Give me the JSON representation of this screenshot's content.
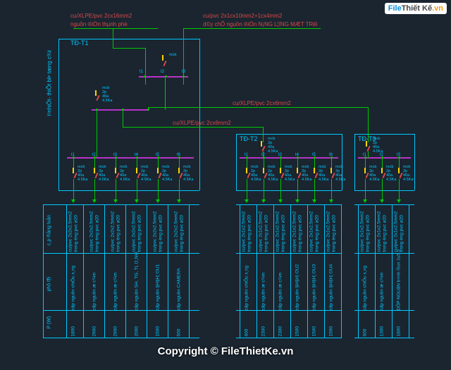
{
  "logo": {
    "text1": "File",
    "text2": "Thiết Kế",
    "text3": ".vn"
  },
  "cables": {
    "c1": "cu/XLPE/pvc 2cx16mm2",
    "c2": "nguồn ®iÖn thµnh phè",
    "c3": "cu/pvc 2x1cx10mm2+1cx4mm2",
    "c4": "d©y chÕ nguồn ®iÖn N¡NG L¦îNG MÆT TRêi",
    "c5": "cu/XLPE/pvc 2cx6mm2",
    "c6": "cu/XLPE/pvc 2cx6mm2"
  },
  "panels": {
    "p1": "TĐ-T1",
    "p2": "TĐ-T2",
    "p3": "TĐ-T3"
  },
  "side_label": "t¹nhiÖt- thiÕt bÞ tæng c¾t",
  "rows": {
    "r1": "c¸p ®ång luån",
    "r2": "phô t¶i",
    "r3": "P (W)"
  },
  "mcb": "mcb\n2p\n40a\n4.5Ka",
  "mcb_text": {
    "l1": "mcb",
    "l2": "2p",
    "l3": "40a",
    "l4": "4.5Ka"
  },
  "t_labels": [
    "t1",
    "t2",
    "t3",
    "t4",
    "t5",
    "t6"
  ],
  "panel1_circuits": [
    {
      "cable": "cu/pvc 2x2x2.5mm2\ntrong èng pvc ø20",
      "load": "cấp nguồn chiÕu s¸ng",
      "p": "1800"
    },
    {
      "cable": "cu/pvc 2x2x2.5mm2\ntrong èng pvc ø20",
      "load": "cấp nguồn æ c¾m",
      "p": "2900"
    },
    {
      "cable": "cu/pvc 2x2x2.5mm2\ntrong èng pvc ø20",
      "load": "cấp nguồn æ c¾m",
      "p": "2900"
    },
    {
      "cable": "cu/pvc 2x2x2.5mm2\ntrong èng pvc ø20",
      "load": "cấp nguồn SH, TG, TL D¸NH",
      "p": "2000"
    },
    {
      "cable": "cu/pvc 2x2x2.5mm2\ntrong èng pvc ø20",
      "load": "cấp nguồn §H§H¦ OU1",
      "p": "1500"
    },
    {
      "cable": "cu/pvc 2x2x2.5mm2\ntrong èng pvc ø20",
      "load": "cấp nguồn CAMERA",
      "p": "500"
    }
  ],
  "panel2_circuits": [
    {
      "cable": "cu/pvc 2x1x2.5mm2\ntrong èng pvc ø20",
      "load": "cấp nguồn chiÕu s¸ng",
      "p": "600"
    },
    {
      "cable": "cu/pvc 2x1x2.5mm2\ntrong èng pvc ø20",
      "load": "cấp nguồn æ c¾m",
      "p": "2300"
    },
    {
      "cable": "cu/pvc 2x1x2.5mm2\ntrong èng pvc ø20",
      "load": "cấp nguồn æ c¾m",
      "p": "2300"
    },
    {
      "cable": "cu/pvc 2x1x2.5mm2\ntrong èng pvc ø20",
      "load": "cấp nguồn §H§H¦ OU2",
      "p": "1500"
    },
    {
      "cable": "cu/pvc 2x1x2.5mm2\ntrong èng pvc ø20",
      "load": "cấp nguồn §H§H¦ OU3",
      "p": "1500"
    },
    {
      "cable": "cu/pvc 2x1x2.5mm2\ntrong èng pvc ø20",
      "load": "cấp nguồn §H§H¦ OU4",
      "p": "1500"
    }
  ],
  "panel3_circuits": [
    {
      "cable": "cu/pvc 2x1x2.5mm2\ntrong èng pvc ø20",
      "load": "cấp nguồn chiÕu s¸ng",
      "p": "600"
    },
    {
      "cable": "cu/pvc 2x1x2.5mm2\ntrong èng pvc ø20",
      "load": "cấp nguồn æ c¾m",
      "p": "1300"
    },
    {
      "cable": "cu/pvc 2x1x2.5mm2\ntrong èng pvc ø20",
      "load": "DÕP NGUåN b×nh ®un 1u5.5",
      "p": "1800"
    }
  ],
  "copyright": "Copyright © FileThietKe.vn"
}
